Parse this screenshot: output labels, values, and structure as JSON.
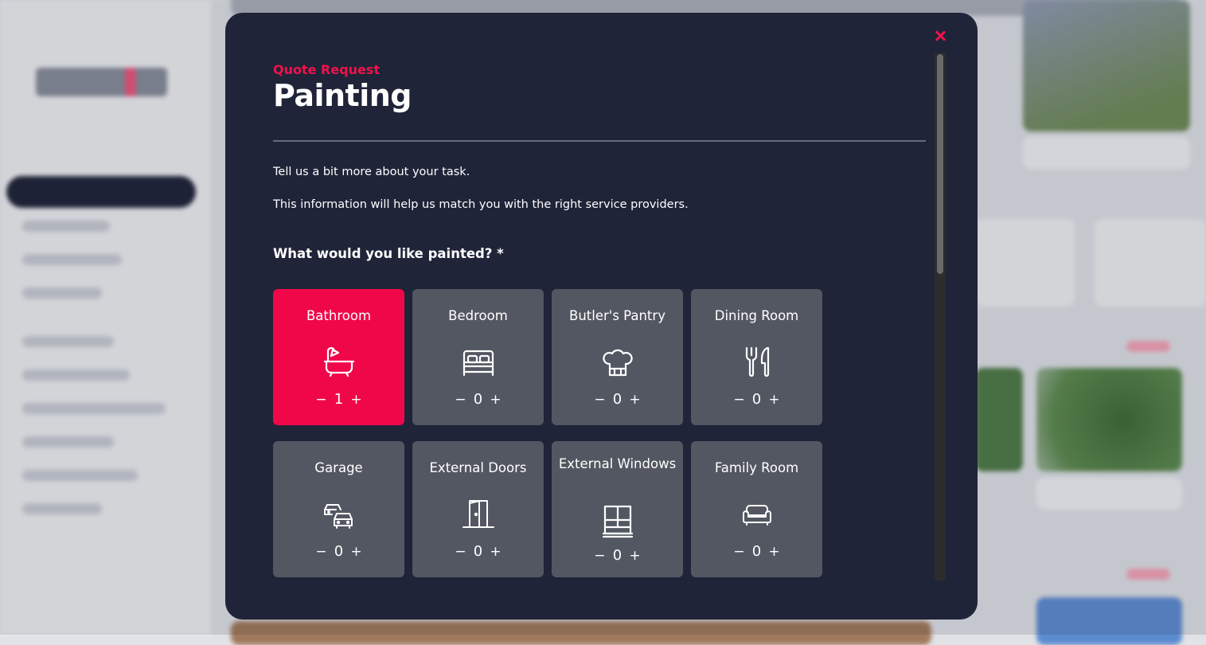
{
  "modal": {
    "eyebrow": "Quote Request",
    "title": "Painting",
    "intro1": "Tell us a bit more about your task.",
    "intro2": "This information will help us match you with the right service providers.",
    "question": "What would you like painted? *",
    "decrement": "−",
    "increment": "+",
    "options": [
      {
        "label": "Bathroom",
        "count": "1",
        "icon": "bathtub-icon",
        "selected": true
      },
      {
        "label": "Bedroom",
        "count": "0",
        "icon": "bed-icon",
        "selected": false
      },
      {
        "label": "Butler's Pantry",
        "count": "0",
        "icon": "chef-hat-icon",
        "selected": false
      },
      {
        "label": "Dining Room",
        "count": "0",
        "icon": "cutlery-icon",
        "selected": false
      },
      {
        "label": "Garage",
        "count": "0",
        "icon": "cars-icon",
        "selected": false
      },
      {
        "label": "External Doors",
        "count": "0",
        "icon": "door-icon",
        "selected": false
      },
      {
        "label": "External Windows",
        "count": "0",
        "icon": "window-icon",
        "selected": false
      },
      {
        "label": "Family Room",
        "count": "0",
        "icon": "sofa-icon",
        "selected": false
      }
    ]
  },
  "colors": {
    "accent": "#f0124c",
    "modal_bg": "#1f2438",
    "tile_bg": "#535762",
    "tile_selected": "#f0074a"
  }
}
